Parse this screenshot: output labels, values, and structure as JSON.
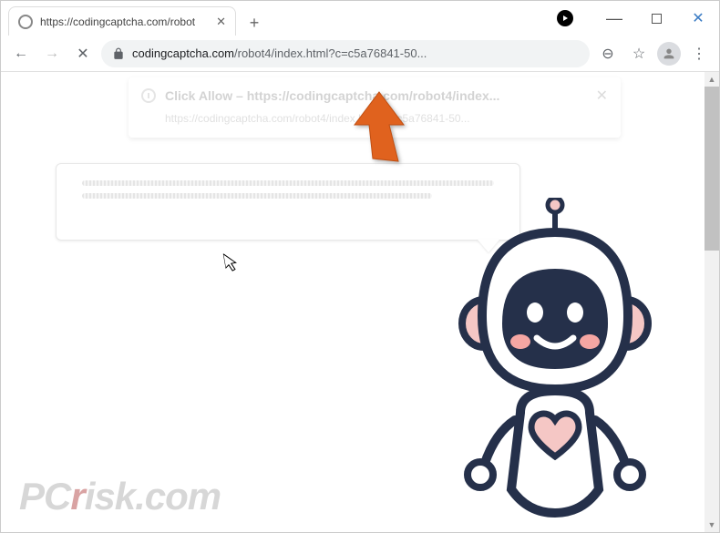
{
  "window": {
    "minimize_label": "—",
    "maximize_label": "",
    "close_label": "✕"
  },
  "tab": {
    "title": "https://codingcaptcha.com/robot",
    "close_label": "✕",
    "newtab_label": "+"
  },
  "toolbar": {
    "back_label": "←",
    "forward_label": "→",
    "stop_label": "✕",
    "zoom_label": "⊖",
    "star_label": "☆",
    "menu_label": "⋮"
  },
  "address": {
    "host": "codingcaptcha.com",
    "path": "/robot4/index.html?c=c5a76841-50..."
  },
  "popup_ghost": {
    "title": "Click Allow – https://codingcaptcha.com/robot4/index...",
    "subtitle": "https://codingcaptcha.com/robot4/index.html?c=c5a76841-50...",
    "close": "✕"
  },
  "watermark": {
    "text_prefix": "PC",
    "text_mid": "r",
    "text_suffix": "isk.com"
  },
  "cursor_glyph": "↖"
}
